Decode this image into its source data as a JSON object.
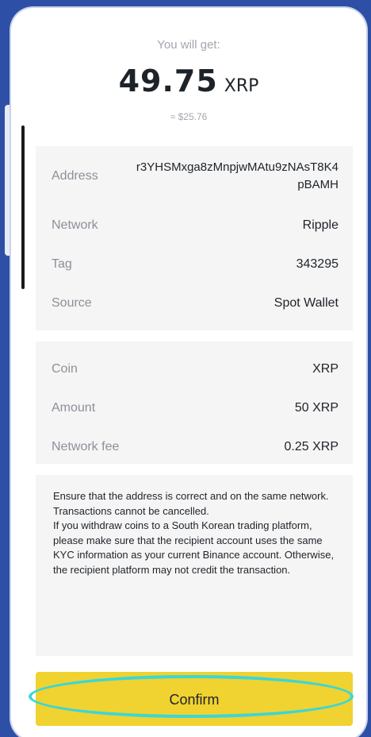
{
  "summary": {
    "you_will_get_label": "You will get:",
    "amount": "49.75",
    "unit": "XRP",
    "usd_equivalent": "≈ $25.76"
  },
  "details": {
    "address": {
      "label": "Address",
      "value": "r3YHSMxga8zMnpjwMAtu9zNAsT8K4pBAMH"
    },
    "network": {
      "label": "Network",
      "value": "Ripple"
    },
    "tag": {
      "label": "Tag",
      "value": "343295"
    },
    "source": {
      "label": "Source",
      "value": "Spot Wallet"
    }
  },
  "breakdown": {
    "coin": {
      "label": "Coin",
      "value": "XRP"
    },
    "amount": {
      "label": "Amount",
      "value": "50 XRP"
    },
    "fee": {
      "label": "Network fee",
      "value": "0.25 XRP"
    }
  },
  "warning": {
    "line1": "Ensure that the address is correct and on the same network.",
    "line2": "Transactions cannot be cancelled.",
    "line3": "If you withdraw coins to a South Korean trading platform, please make sure that the recipient account uses the same KYC information as your current Binance account. Otherwise, the recipient platform may not credit the transaction."
  },
  "confirm_button": {
    "label": "Confirm"
  },
  "colors": {
    "background": "#2d4fa6",
    "accent": "#f0d230",
    "highlight": "#3ad7d7"
  }
}
